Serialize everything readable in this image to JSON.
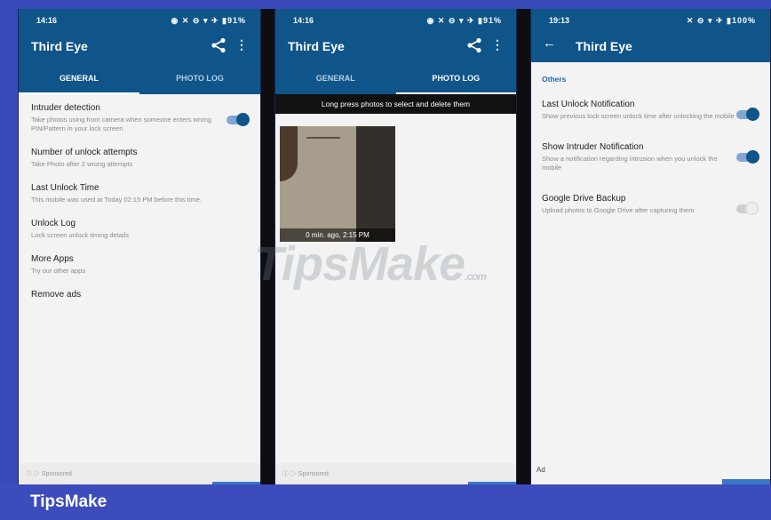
{
  "phone1": {
    "status_time": "14:16",
    "status_right": "◉ ✕ ⊖ ▾ ✈ ▮91%",
    "title": "Third Eye",
    "tabs": [
      "GENERAL",
      "PHOTO LOG"
    ],
    "settings": [
      {
        "title": "Intruder detection",
        "subtitle": "Take photos using front camera when someone enters wrong PIN/Pattern in your lock screen",
        "toggle": "on"
      },
      {
        "title": "Number of unlock attempts",
        "subtitle": "Take Photo after 2 wrong attempts"
      },
      {
        "title": "Last Unlock Time",
        "subtitle": "This mobile was used at Today 02:15 PM before this time."
      },
      {
        "title": "Unlock Log",
        "subtitle": "Lock screen unlock timing details"
      },
      {
        "title": "More Apps",
        "subtitle": "Try our other apps"
      },
      {
        "title": "Remove ads",
        "subtitle": ""
      }
    ],
    "ad_text": "ⓘ ▷ Sponsored"
  },
  "phone2": {
    "status_time": "14:16",
    "status_right": "◉ ✕ ⊖ ▾ ✈ ▮91%",
    "title": "Third Eye",
    "tabs": [
      "GENERAL",
      "PHOTO LOG"
    ],
    "notice": "Long press photos to select and delete them",
    "photo_caption": "0 min. ago, 2:15 PM",
    "ad_text": "ⓘ ▷ Sponsored"
  },
  "phone3": {
    "status_time": "19:13",
    "status_right": "✕ ⊖ ▾ ✈ ▮100%",
    "title": "Third Eye",
    "section": "Others",
    "settings": [
      {
        "title": "Last Unlock Notification",
        "subtitle": "Show previous lock screen unlock time after unlocking the mobile",
        "toggle": "on"
      },
      {
        "title": "Show Intruder Notification",
        "subtitle": "Show a notification regarding intrusion when you unlock the mobile",
        "toggle": "on"
      },
      {
        "title": "Google Drive Backup",
        "subtitle": "Upload photos to Google Drive after capturing them",
        "toggle": "off"
      }
    ],
    "ad_label": "Ad"
  },
  "watermark": "TipsMake",
  "watermark_suffix": ".com",
  "footer": "TipsMake",
  "colors": {
    "appbar": "#0f5589",
    "accent": "#1c67b5",
    "background": "#3a4ab8"
  }
}
